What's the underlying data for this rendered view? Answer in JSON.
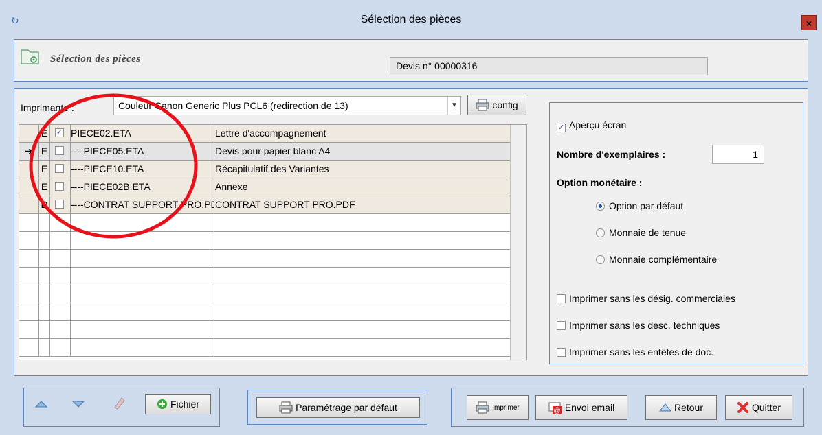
{
  "window": {
    "title": "Sélection des pièces",
    "close_glyph": "×",
    "app_icon": "↻"
  },
  "header": {
    "title": "Sélection des pièces",
    "devis_label": "Devis n° 00000316"
  },
  "printer": {
    "label": "Imprimante :",
    "value": "Couleur Canon Generic Plus PCL6 (redirection de 13)",
    "config_label": "config"
  },
  "grid": {
    "rows": [
      {
        "pointer": "",
        "type": "E",
        "checked": true,
        "file": "PIECE02.ETA",
        "description": "Lettre d'accompagnement"
      },
      {
        "pointer": "➔",
        "type": "E",
        "checked": false,
        "file": "----PIECE05.ETA",
        "description": "Devis pour papier blanc A4"
      },
      {
        "pointer": "",
        "type": "E",
        "checked": false,
        "file": "----PIECE10.ETA",
        "description": "Récapitulatif des Variantes"
      },
      {
        "pointer": "",
        "type": "E",
        "checked": false,
        "file": "----PIECE02B.ETA",
        "description": "Annexe"
      },
      {
        "pointer": "",
        "type": "D",
        "checked": false,
        "file": "----CONTRAT SUPPORT PRO.PDF",
        "description": "CONTRAT SUPPORT PRO.PDF"
      }
    ]
  },
  "options": {
    "apercu_label": "Aperçu écran",
    "apercu_checked": true,
    "nb_label": "Nombre d'exemplaires :",
    "nb_value": "1",
    "monetaire_label": "Option monétaire :",
    "radios": [
      {
        "label": "Option par défaut",
        "selected": true
      },
      {
        "label": "Monnaie de tenue",
        "selected": false
      },
      {
        "label": "Monnaie complémentaire",
        "selected": false
      }
    ],
    "checks": [
      {
        "label": "Imprimer sans les désig. commerciales",
        "checked": false
      },
      {
        "label": "Imprimer sans les desc. techniques",
        "checked": false
      },
      {
        "label": "Imprimer sans les entêtes de doc.",
        "checked": false
      }
    ]
  },
  "bottom": {
    "fichier_label": "Fichier",
    "param_label": "Paramétrage par défaut",
    "imprimer_label": "Imprimer",
    "email_label": "Envoi email",
    "retour_label": "Retour",
    "quitter_label": "Quitter"
  },
  "annotation": {
    "color": "#e8111a"
  }
}
